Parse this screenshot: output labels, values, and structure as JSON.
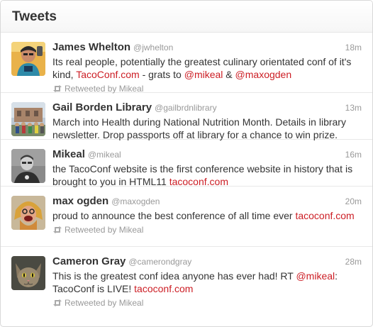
{
  "panel": {
    "title": "Tweets"
  },
  "colors": {
    "link": "#cc1d24",
    "meta": "#999999",
    "text": "#333333"
  },
  "tweets": [
    {
      "avatar_icon": "avatar-james-whelton",
      "name": "James Whelton",
      "handle": "@jwhelton",
      "time": "18m",
      "text_1": "Its real people, potentially the greatest culinary orientated conf of it's kind, ",
      "link_1": "TacoConf.com",
      "text_2": " - grats to ",
      "link_2": "@mikeal",
      "text_3": " & ",
      "link_3": "@maxogden",
      "retweet": "Retweeted by Mikeal"
    },
    {
      "avatar_icon": "avatar-gail-borden-library",
      "name": "Gail Borden Library",
      "handle": "@gailbrdnlibrary",
      "time": "13m",
      "text_1": "March into Health during National Nutrition Month. Details in library newsletter. Drop passports off at library for a chance to win prize."
    },
    {
      "avatar_icon": "avatar-mikeal",
      "name": "Mikeal",
      "handle": "@mikeal",
      "time": "16m",
      "text_1": "the TacoConf website is the first conference website in history that is brought to you in HTML11 ",
      "link_1": "tacoconf.com"
    },
    {
      "avatar_icon": "avatar-max-ogden",
      "name": "max ogden",
      "handle": "@maxogden",
      "time": "20m",
      "text_1": "proud to announce the best conference of all time ever ",
      "link_1": "tacoconf.com",
      "retweet": "Retweeted by Mikeal"
    },
    {
      "avatar_icon": "avatar-cameron-gray",
      "name": "Cameron Gray",
      "handle": "@camerondgray",
      "time": "28m",
      "text_1": "This is the greatest conf idea anyone has ever had! RT ",
      "link_1": "@mikeal",
      "text_2": ": TacoConf is LIVE! ",
      "link_2": "tacoconf.com",
      "retweet": "Retweeted by Mikeal"
    }
  ]
}
